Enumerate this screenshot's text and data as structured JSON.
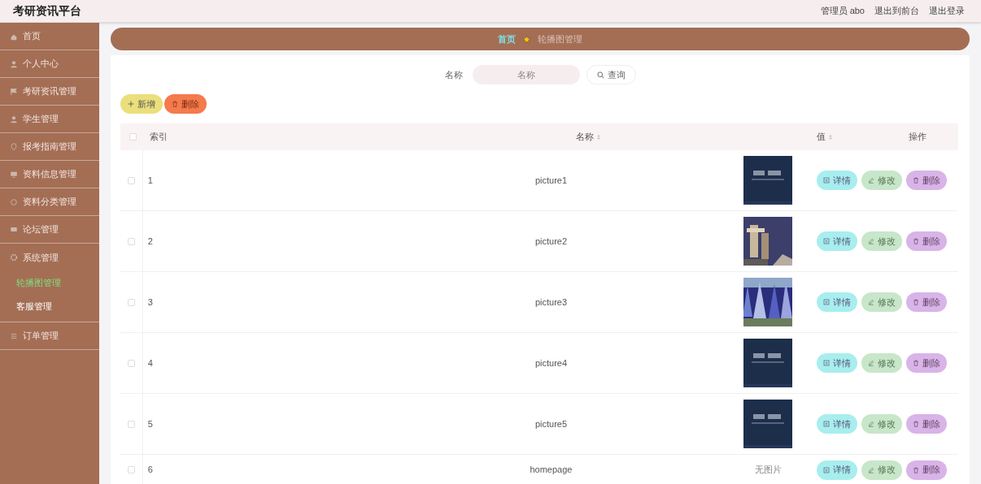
{
  "header": {
    "title": "考研资讯平台",
    "links": [
      "管理员 abo",
      "退出到前台",
      "退出登录"
    ]
  },
  "sidebar": {
    "items": [
      {
        "label": "首页"
      },
      {
        "label": "个人中心"
      },
      {
        "label": "考研资讯管理"
      },
      {
        "label": "学生管理"
      },
      {
        "label": "报考指南管理"
      },
      {
        "label": "资料信息管理"
      },
      {
        "label": "资料分类管理"
      },
      {
        "label": "论坛管理"
      },
      {
        "label": "系统管理",
        "children": [
          {
            "label": "轮播图管理",
            "selected": true
          },
          {
            "label": "客服管理",
            "selected": false
          }
        ]
      },
      {
        "label": "订单管理"
      }
    ]
  },
  "breadcrumb": [
    "首页",
    "轮播图管理"
  ],
  "search": {
    "label": "名称",
    "placeholder": "名称",
    "button": "查询"
  },
  "actions": [
    {
      "label": "新增",
      "kind": "add"
    },
    {
      "label": "删除",
      "kind": "delete"
    }
  ],
  "table": {
    "select_all_checked": false,
    "columns": [
      {
        "label": "索引",
        "sortable": false
      },
      {
        "label": "名称",
        "sortable": true
      },
      {
        "label": "值",
        "sortable": true
      },
      {
        "label": "操作",
        "sortable": false
      }
    ],
    "rows": [
      {
        "checked": false,
        "index": "1",
        "name": "picture1",
        "value": {
          "kind": "picture"
        },
        "buttons": [
          {
            "label": "详情",
            "kind": "detail"
          },
          {
            "label": "修改",
            "kind": "edit"
          },
          {
            "label": "删除",
            "kind": "delete"
          }
        ]
      },
      {
        "checked": false,
        "index": "2",
        "name": "picture2",
        "value": {
          "kind": "picture"
        },
        "buttons": [
          {
            "label": "详情",
            "kind": "detail"
          },
          {
            "label": "修改",
            "kind": "edit"
          },
          {
            "label": "删除",
            "kind": "delete"
          }
        ]
      },
      {
        "checked": false,
        "index": "3",
        "name": "picture3",
        "value": {
          "kind": "picture"
        },
        "buttons": [
          {
            "label": "详情",
            "kind": "detail"
          },
          {
            "label": "修改",
            "kind": "edit"
          },
          {
            "label": "删除",
            "kind": "delete"
          }
        ]
      },
      {
        "checked": false,
        "index": "4",
        "name": "picture4",
        "value": {
          "kind": "picture"
        },
        "buttons": [
          {
            "label": "详情",
            "kind": "detail"
          },
          {
            "label": "修改",
            "kind": "edit"
          },
          {
            "label": "删除",
            "kind": "delete"
          }
        ]
      },
      {
        "checked": false,
        "index": "5",
        "name": "picture5",
        "value": {
          "kind": "picture"
        },
        "buttons": [
          {
            "label": "详情",
            "kind": "detail"
          },
          {
            "label": "修改",
            "kind": "edit"
          },
          {
            "label": "删除",
            "kind": "delete"
          }
        ]
      },
      {
        "checked": false,
        "index": "6",
        "name": "homepage",
        "value": {
          "kind": "text",
          "text": "无图片"
        },
        "buttons": [
          {
            "label": "详情",
            "kind": "detail"
          },
          {
            "label": "修改",
            "kind": "edit"
          },
          {
            "label": "删除",
            "kind": "delete"
          }
        ]
      }
    ]
  }
}
